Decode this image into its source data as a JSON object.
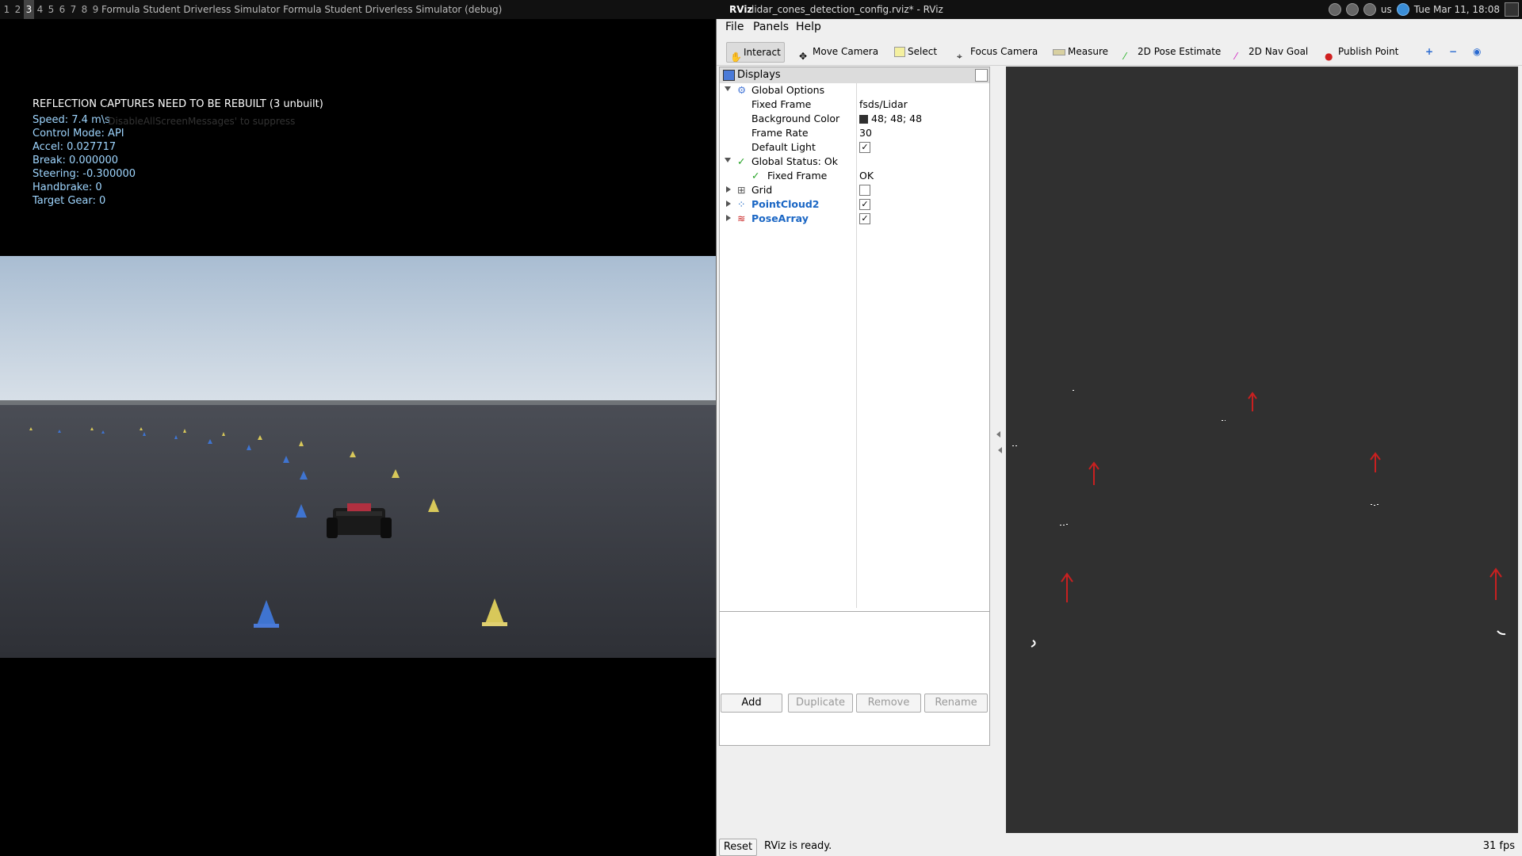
{
  "topbar": {
    "workspaces": [
      "1",
      "2",
      "3",
      "4",
      "5",
      "6",
      "7",
      "8",
      "9"
    ],
    "active_workspace": "3",
    "sim_window_titles": "Formula Student Driverless Simulator Formula Student Driverless Simulator (debug)",
    "rviz_logo": "RViz",
    "rviz_window_title": "lidar_cones_detection_config.rviz* - RViz",
    "keyboard_layout": "us",
    "clock": "Tue Mar 11, 18:08"
  },
  "sim": {
    "warning": "REFLECTION CAPTURES NEED TO BE REBUILT (3 unbuilt)",
    "screen_messages_hint": "'DisableAllScreenMessages' to suppress",
    "hud": {
      "speed": "Speed: 7.4 m\\s",
      "control_mode": "Control Mode: API",
      "accel": "Accel: 0.027717",
      "brake": "Break: 0.000000",
      "steering": "Steering: -0.300000",
      "handbrake": "Handbrake: 0",
      "target_gear": "Target Gear: 0"
    },
    "colors": {
      "blue_cone": "#3f74d0",
      "yellow_cone": "#d8c85a",
      "sky": "#b8c8d8",
      "ground": "#3a3d45"
    }
  },
  "rviz": {
    "menu": {
      "file": "File",
      "panels": "Panels",
      "help": "Help"
    },
    "toolbar": {
      "interact": "Interact",
      "move_camera": "Move Camera",
      "select": "Select",
      "focus_camera": "Focus Camera",
      "measure": "Measure",
      "pose_estimate": "2D Pose Estimate",
      "nav_goal": "2D Nav Goal",
      "publish_point": "Publish Point"
    },
    "displays": {
      "title": "Displays",
      "global_options": "Global Options",
      "fixed_frame_label": "Fixed Frame",
      "fixed_frame_value": "fsds/Lidar",
      "bg_color_label": "Background Color",
      "bg_color_value": "48; 48; 48",
      "frame_rate_label": "Frame Rate",
      "frame_rate_value": "30",
      "default_light_label": "Default Light",
      "global_status": "Global Status: Ok",
      "status_fixed_frame_label": "Fixed Frame",
      "status_fixed_frame_value": "OK",
      "grid": "Grid",
      "pointcloud2": "PointCloud2",
      "posearray": "PoseArray",
      "check_mark": "✓"
    },
    "buttons": {
      "add": "Add",
      "duplicate": "Duplicate",
      "remove": "Remove",
      "rename": "Rename"
    },
    "status": {
      "reset": "Reset",
      "message": "RViz is ready.",
      "fps": "31 fps"
    },
    "colors": {
      "view_bg": "#303030",
      "pose_arrow": "#c82020",
      "link_blue": "#1a66c4"
    }
  }
}
